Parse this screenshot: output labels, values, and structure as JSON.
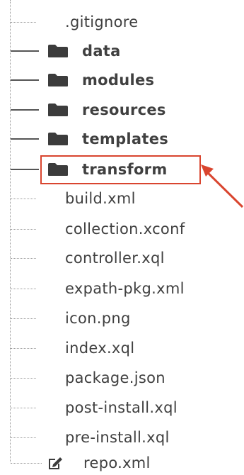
{
  "tree": {
    "items": [
      {
        "type": "file",
        "label": ".gitignore",
        "icon": null
      },
      {
        "type": "folder",
        "label": "data",
        "icon": "folder-icon"
      },
      {
        "type": "folder",
        "label": "modules",
        "icon": "folder-icon"
      },
      {
        "type": "folder",
        "label": "resources",
        "icon": "folder-icon"
      },
      {
        "type": "folder",
        "label": "templates",
        "icon": "folder-icon"
      },
      {
        "type": "folder",
        "label": "transform",
        "icon": "folder-icon",
        "highlighted": true
      },
      {
        "type": "file",
        "label": "build.xml",
        "icon": null
      },
      {
        "type": "file",
        "label": "collection.xconf",
        "icon": null
      },
      {
        "type": "file",
        "label": "controller.xql",
        "icon": null
      },
      {
        "type": "file",
        "label": "expath-pkg.xml",
        "icon": null
      },
      {
        "type": "file",
        "label": "icon.png",
        "icon": null
      },
      {
        "type": "file",
        "label": "index.xql",
        "icon": null
      },
      {
        "type": "file",
        "label": "package.json",
        "icon": null
      },
      {
        "type": "file",
        "label": "post-install.xql",
        "icon": null
      },
      {
        "type": "file",
        "label": "pre-install.xql",
        "icon": null
      },
      {
        "type": "file",
        "label": "repo.xml",
        "icon": "edit-icon"
      }
    ]
  },
  "colors": {
    "highlight": "#d9452f",
    "text": "#404040",
    "connector": "#555555",
    "dotted": "#9a9a9a"
  }
}
